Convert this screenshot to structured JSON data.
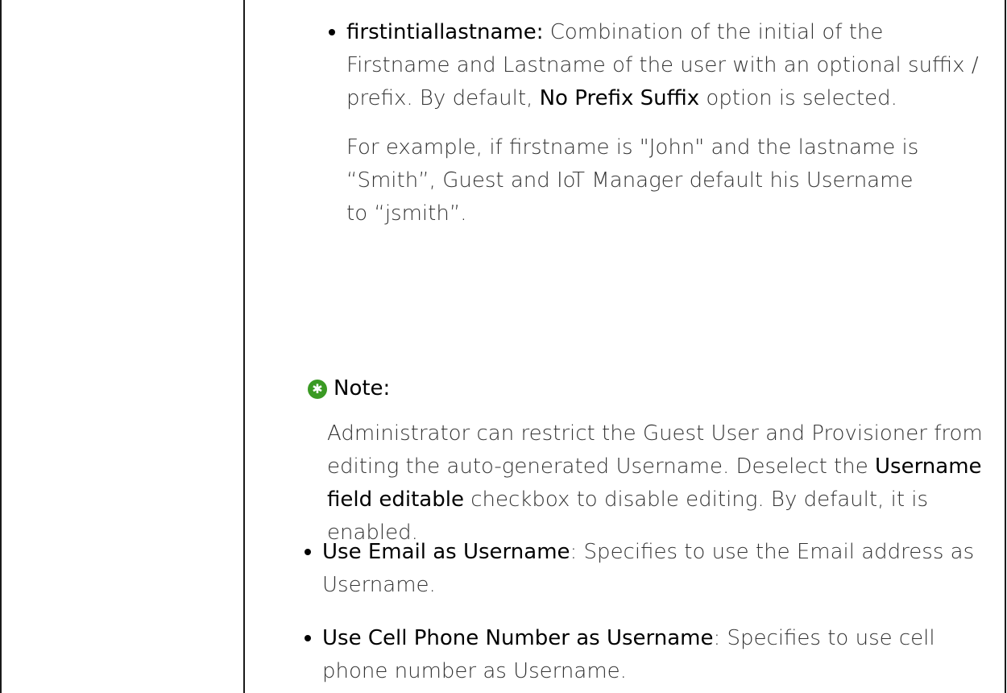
{
  "item_firstinitial": {
    "term": "firstintiallastname:",
    "desc_1": " Combination of the initial of the Firstname and Lastname of the user with an optional suffix / prefix. By default, ",
    "bold_option": "No Prefix Suffix",
    "desc_2": " option is selected.",
    "example": "For example, if firstname is \"John\" and the lastname is “Smith”, Guest and IoT Manager default his Username to “jsmith”."
  },
  "note": {
    "icon": "green-star-circle-icon",
    "title": "Note:",
    "text_1": "Administrator can restrict the Guest User and Provisioner from editing the auto-generated Username. Deselect the ",
    "bold_field": "Username field editable",
    "text_2": " checkbox to disable editing. By default, it is enabled."
  },
  "item_email": {
    "term": "Use Email as Username",
    "desc": ": Specifies to use the Email address as Username."
  },
  "item_phone": {
    "term": "Use Cell Phone Number as Username",
    "desc": ": Specifies to use cell phone number as Username."
  },
  "colors": {
    "text": "#333333",
    "bold": "#000000",
    "note_icon": "#3a9a23",
    "border": "#1a1a1a"
  }
}
